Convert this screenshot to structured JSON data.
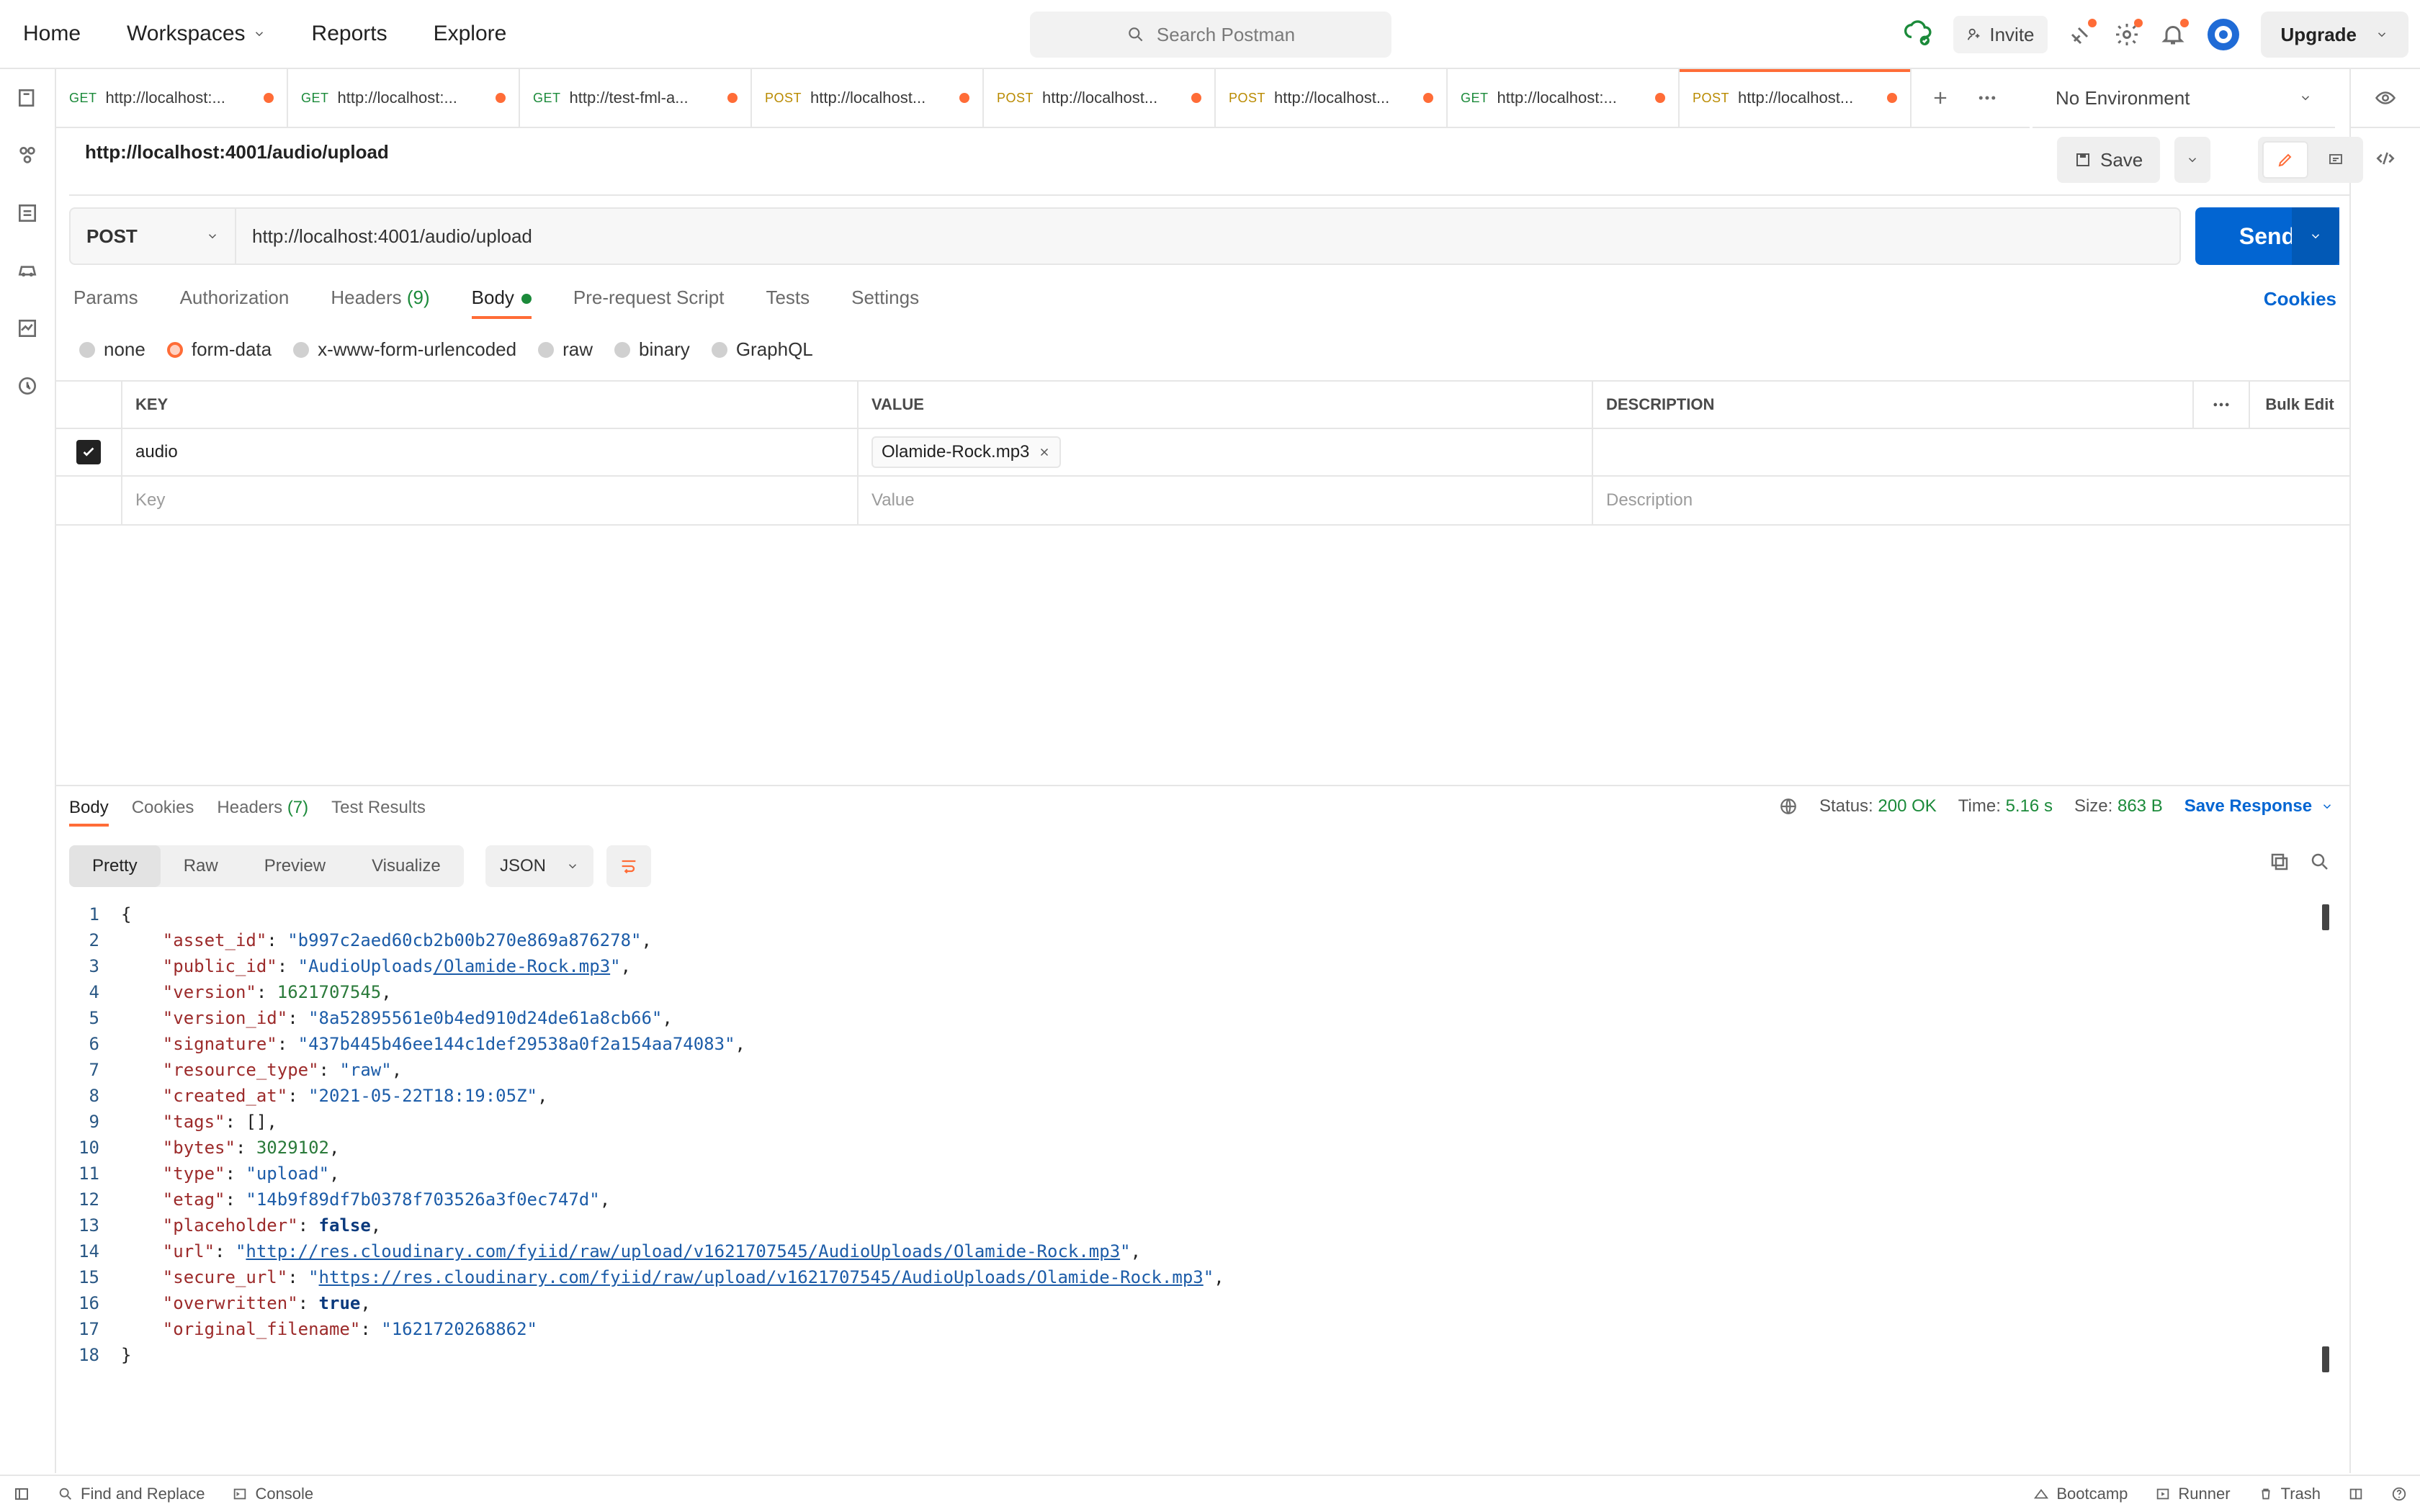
{
  "topbar": {
    "nav": {
      "home": "Home",
      "workspaces": "Workspaces",
      "reports": "Reports",
      "explore": "Explore"
    },
    "search_placeholder": "Search Postman",
    "invite": "Invite",
    "upgrade": "Upgrade"
  },
  "tabs": [
    {
      "method": "GET",
      "url": "http://localhost:..."
    },
    {
      "method": "GET",
      "url": "http://localhost:..."
    },
    {
      "method": "GET",
      "url": "http://test-fml-a..."
    },
    {
      "method": "POST",
      "url": "http://localhost..."
    },
    {
      "method": "POST",
      "url": "http://localhost..."
    },
    {
      "method": "POST",
      "url": "http://localhost..."
    },
    {
      "method": "GET",
      "url": "http://localhost:..."
    },
    {
      "method": "POST",
      "url": "http://localhost...",
      "active": true
    }
  ],
  "environment": "No Environment",
  "request": {
    "title": "http://localhost:4001/audio/upload",
    "save": "Save",
    "method": "POST",
    "url": "http://localhost:4001/audio/upload",
    "send": "Send",
    "subtabs": {
      "params": "Params",
      "authorization": "Authorization",
      "headers": "Headers",
      "headers_count": "(9)",
      "body": "Body",
      "prerequest": "Pre-request Script",
      "tests": "Tests",
      "settings": "Settings"
    },
    "cookies": "Cookies",
    "body_options": {
      "none": "none",
      "form_data": "form-data",
      "urlencoded": "x-www-form-urlencoded",
      "raw": "raw",
      "binary": "binary",
      "graphql": "GraphQL"
    },
    "table": {
      "headers": {
        "key": "KEY",
        "value": "VALUE",
        "description": "DESCRIPTION",
        "bulk_edit": "Bulk Edit"
      },
      "row": {
        "key": "audio",
        "value": "Olamide-Rock.mp3",
        "description": ""
      },
      "placeholder": {
        "key": "Key",
        "value": "Value",
        "description": "Description"
      }
    }
  },
  "response": {
    "tabs": {
      "body": "Body",
      "cookies": "Cookies",
      "headers": "Headers",
      "headers_count": "(7)",
      "tests": "Test Results"
    },
    "status_label": "Status:",
    "status": "200 OK",
    "time_label": "Time:",
    "time": "5.16 s",
    "size_label": "Size:",
    "size": "863 B",
    "save_response": "Save Response",
    "viewer": {
      "pretty": "Pretty",
      "raw": "Raw",
      "preview": "Preview",
      "visualize": "Visualize"
    },
    "format": "JSON",
    "json": {
      "asset_id": "b997c2aed60cb2b00b270e869a876278",
      "public_id_prefix": "AudioUploads",
      "public_id_suffix": "/Olamide-Rock.mp3",
      "version": "1621707545",
      "version_id": "8a52895561e0b4ed910d24de61a8cb66",
      "signature": "437b445b46ee144c1def29538a0f2a154aa74083",
      "resource_type": "raw",
      "created_at": "2021-05-22T18:19:05Z",
      "tags": "[]",
      "bytes": "3029102",
      "type": "upload",
      "etag": "14b9f89df7b0378f703526a3f0ec747d",
      "placeholder": "false",
      "url": "http://res.cloudinary.com/fyiid/raw/upload/v1621707545/AudioUploads/Olamide-Rock.mp3",
      "secure_url": "https://res.cloudinary.com/fyiid/raw/upload/v1621707545/AudioUploads/Olamide-Rock.mp3",
      "overwritten": "true",
      "original_filename": "1621720268862"
    }
  },
  "bottombar": {
    "find_replace": "Find and Replace",
    "console": "Console",
    "bootcamp": "Bootcamp",
    "runner": "Runner",
    "trash": "Trash"
  }
}
